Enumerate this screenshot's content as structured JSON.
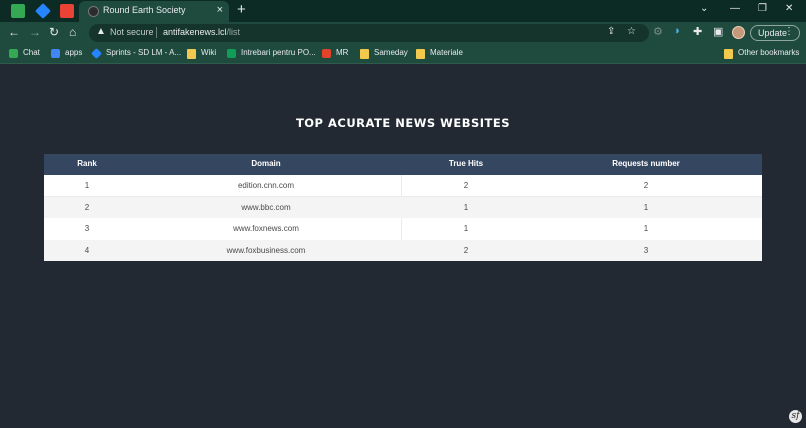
{
  "browser": {
    "tab_title": "Round Earth Society",
    "close_tab": "×",
    "new_tab": "+",
    "address": {
      "security_text": "Not secure",
      "host": "antifakenews.lcl",
      "path": "/list"
    },
    "update_label": "Update",
    "bookmarks": [
      {
        "label": "Chat",
        "icon": "chat-icon",
        "color": "#34a853"
      },
      {
        "label": "apps",
        "icon": "apps-icon",
        "color": "#4285f4"
      },
      {
        "label": "Sprints - SD LM - A...",
        "icon": "jira-icon",
        "color": "#2684ff"
      },
      {
        "label": "Wiki",
        "icon": "folder-icon",
        "color": "#f2c94c"
      },
      {
        "label": "Intrebari pentru PO...",
        "icon": "sheets-icon",
        "color": "#0f9d58"
      },
      {
        "label": "MR",
        "icon": "gitlab-icon",
        "color": "#e24329"
      },
      {
        "label": "Sameday",
        "icon": "folder-icon",
        "color": "#f2c94c"
      },
      {
        "label": "Materiale",
        "icon": "folder-icon",
        "color": "#f2c94c"
      }
    ],
    "other_bookmarks": "Other bookmarks"
  },
  "page": {
    "title": "TOP ACURATE NEWS WEBSITES",
    "columns": [
      "Rank",
      "Domain",
      "True Hits",
      "Requests number"
    ],
    "rows": [
      {
        "rank": "1",
        "domain": "edition.cnn.com",
        "true_hits": "2",
        "requests": "2"
      },
      {
        "rank": "2",
        "domain": "www.bbc.com",
        "true_hits": "1",
        "requests": "1"
      },
      {
        "rank": "3",
        "domain": "www.foxnews.com",
        "true_hits": "1",
        "requests": "1"
      },
      {
        "rank": "4",
        "domain": "www.foxbusiness.com",
        "true_hits": "2",
        "requests": "3"
      }
    ]
  },
  "colors": {
    "page_bg": "#222933",
    "header_bg": "#354760",
    "browser_frame": "#1f4a3e"
  }
}
